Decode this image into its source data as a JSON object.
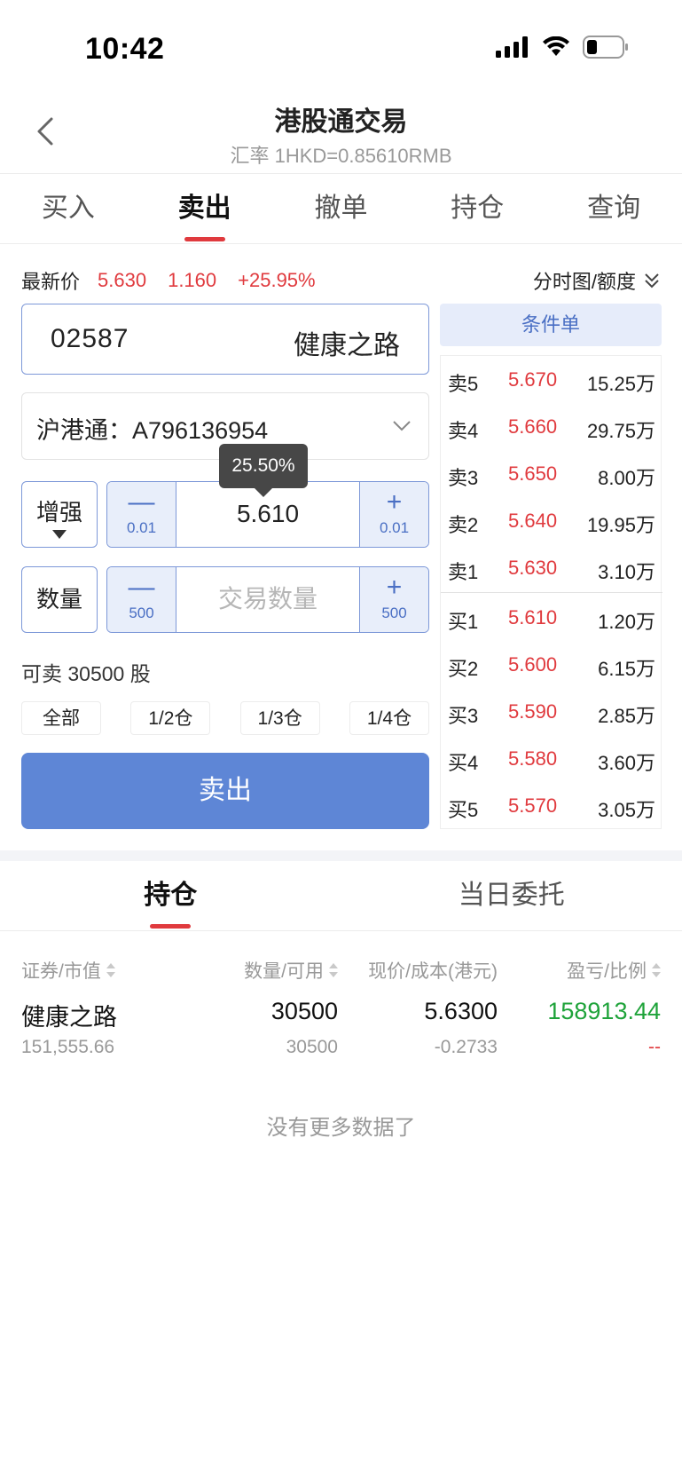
{
  "status_bar": {
    "time": "10:42"
  },
  "header": {
    "title": "港股通交易",
    "subtitle": "汇率 1HKD=0.85610RMB"
  },
  "tabs": [
    "买入",
    "卖出",
    "撤单",
    "持仓",
    "查询"
  ],
  "active_tab": "卖出",
  "quote": {
    "label": "最新价",
    "price": "5.630",
    "change": "1.160",
    "change_pct": "+25.95%"
  },
  "chart_toggle": "分时图/额度",
  "stock": {
    "code": "02587",
    "name": "健康之路"
  },
  "account": "沪港通：A796136954",
  "price_input": {
    "mode": "增强",
    "value": "5.610",
    "step_minus": "0.01",
    "step_plus": "0.01",
    "tooltip": "25.50%",
    "minus_symbol": "—",
    "plus_symbol": "+"
  },
  "qty_input": {
    "label": "数量",
    "placeholder": "交易数量",
    "step_minus": "500",
    "step_plus": "500",
    "minus_symbol": "—",
    "plus_symbol": "+"
  },
  "available": "可卖 30500 股",
  "ratios": [
    "全部",
    "1/2仓",
    "1/3仓",
    "1/4仓"
  ],
  "sell_button": "卖出",
  "condition_button": "条件单",
  "order_book": {
    "asks": [
      {
        "level": "卖5",
        "price": "5.670",
        "volume": "15.25万"
      },
      {
        "level": "卖4",
        "price": "5.660",
        "volume": "29.75万"
      },
      {
        "level": "卖3",
        "price": "5.650",
        "volume": "8.00万"
      },
      {
        "level": "卖2",
        "price": "5.640",
        "volume": "19.95万"
      },
      {
        "level": "卖1",
        "price": "5.630",
        "volume": "3.10万"
      }
    ],
    "bids": [
      {
        "level": "买1",
        "price": "5.610",
        "volume": "1.20万"
      },
      {
        "level": "买2",
        "price": "5.600",
        "volume": "6.15万"
      },
      {
        "level": "买3",
        "price": "5.590",
        "volume": "2.85万"
      },
      {
        "level": "买4",
        "price": "5.580",
        "volume": "3.60万"
      },
      {
        "level": "买5",
        "price": "5.570",
        "volume": "3.05万"
      }
    ]
  },
  "lower_tabs": [
    "持仓",
    "当日委托"
  ],
  "positions_header": [
    "证券/市值",
    "数量/可用",
    "现价/成本(港元)",
    "盈亏/比例"
  ],
  "positions": [
    {
      "name": "健康之路",
      "market_value": "151,555.66",
      "quantity": "30500",
      "available": "30500",
      "price": "5.6300",
      "cost": "-0.2733",
      "pnl": "158913.44",
      "pnl_ratio": "--"
    }
  ],
  "no_more": "没有更多数据了",
  "colors": {
    "red": "#e03a3e",
    "green": "#1fa33a",
    "accent_blue": "#5e86d6"
  }
}
